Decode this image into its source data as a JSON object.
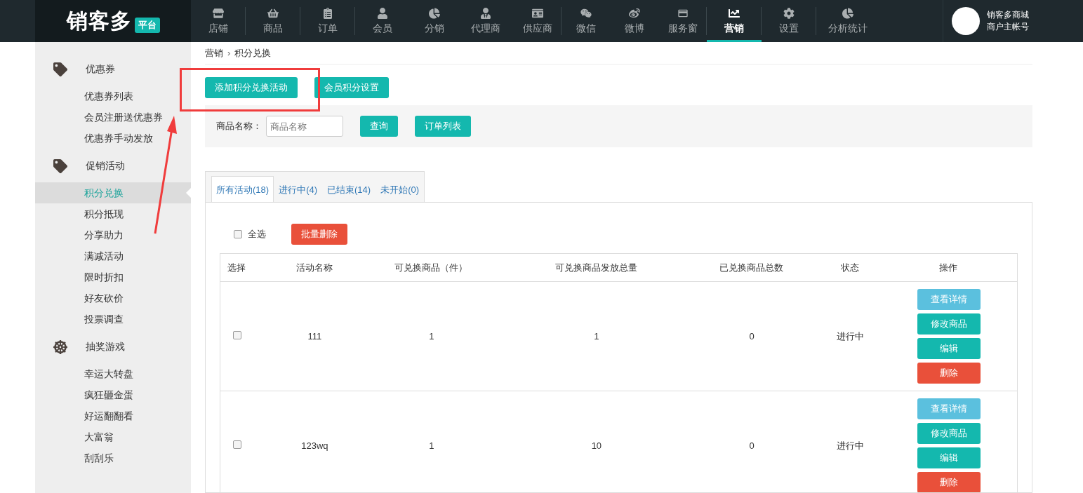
{
  "header": {
    "logo": "销客多",
    "logo_badge": "平台",
    "nav": [
      {
        "label": "店铺",
        "selected": false
      },
      {
        "label": "商品",
        "selected": false
      },
      {
        "label": "订单",
        "selected": false
      },
      {
        "label": "会员",
        "selected": false
      },
      {
        "label": "分销",
        "selected": false
      },
      {
        "label": "代理商",
        "selected": false
      },
      {
        "label": "供应商",
        "selected": false
      },
      {
        "label": "微信",
        "selected": false
      },
      {
        "label": "微博",
        "selected": false
      },
      {
        "label": "服务窗",
        "selected": false
      },
      {
        "label": "营销",
        "selected": true
      },
      {
        "label": "设置",
        "selected": false
      },
      {
        "label": "分析统计",
        "selected": false
      }
    ],
    "account": {
      "name": "销客多商城",
      "role": "商户主帐号"
    }
  },
  "sidebar": [
    {
      "title": "优惠券",
      "items": [
        {
          "label": "优惠券列表",
          "selected": false
        },
        {
          "label": "会员注册送优惠券",
          "selected": false
        },
        {
          "label": "优惠券手动发放",
          "selected": false
        }
      ]
    },
    {
      "title": "促销活动",
      "items": [
        {
          "label": "积分兑换",
          "selected": true
        },
        {
          "label": "积分抵现",
          "selected": false
        },
        {
          "label": "分享助力",
          "selected": false
        },
        {
          "label": "满减活动",
          "selected": false
        },
        {
          "label": "限时折扣",
          "selected": false
        },
        {
          "label": "好友砍价",
          "selected": false
        },
        {
          "label": "投票调查",
          "selected": false
        }
      ]
    },
    {
      "title": "抽奖游戏",
      "items": [
        {
          "label": "幸运大转盘",
          "selected": false
        },
        {
          "label": "疯狂砸金蛋",
          "selected": false
        },
        {
          "label": "好运翻翻看",
          "selected": false
        },
        {
          "label": "大富翁",
          "selected": false
        },
        {
          "label": "刮刮乐",
          "selected": false
        }
      ]
    }
  ],
  "breadcrumb": {
    "items": [
      "营销",
      "积分兑换"
    ],
    "separator": "›"
  },
  "actions": [
    "添加积分兑换活动",
    "会员积分设置"
  ],
  "search": {
    "label": "商品名称：",
    "placeholder": "商品名称",
    "buttons": [
      "查询",
      "订单列表"
    ]
  },
  "tabs": [
    {
      "label": "所有活动(18)",
      "selected": true
    },
    {
      "label": "进行中(4)",
      "selected": false
    },
    {
      "label": "已结束(14)",
      "selected": false
    },
    {
      "label": "未开始(0)",
      "selected": false
    }
  ],
  "select_all": {
    "label": "全选",
    "checked": false
  },
  "batch_delete": "批量删除",
  "table": {
    "columns": [
      "选择",
      "活动名称",
      "可兑换商品（件）",
      "可兑换商品发放总量",
      "已兑换商品总数",
      "状态",
      "操作"
    ],
    "rows": [
      {
        "checked": false,
        "cells": [
          "",
          "111",
          "1",
          "1",
          "0",
          "进行中"
        ],
        "buttons": [
          {
            "label": "查看详情",
            "kind": "info"
          },
          {
            "label": "修改商品",
            "kind": "primary"
          },
          {
            "label": "编辑",
            "kind": "primary"
          },
          {
            "label": "删除",
            "kind": "danger"
          }
        ]
      },
      {
        "checked": false,
        "cells": [
          "",
          "123wq",
          "1",
          "10",
          "0",
          "进行中"
        ],
        "buttons": [
          {
            "label": "查看详情",
            "kind": "info"
          },
          {
            "label": "修改商品",
            "kind": "primary"
          },
          {
            "label": "编辑",
            "kind": "primary"
          },
          {
            "label": "删除",
            "kind": "danger"
          }
        ]
      }
    ]
  }
}
